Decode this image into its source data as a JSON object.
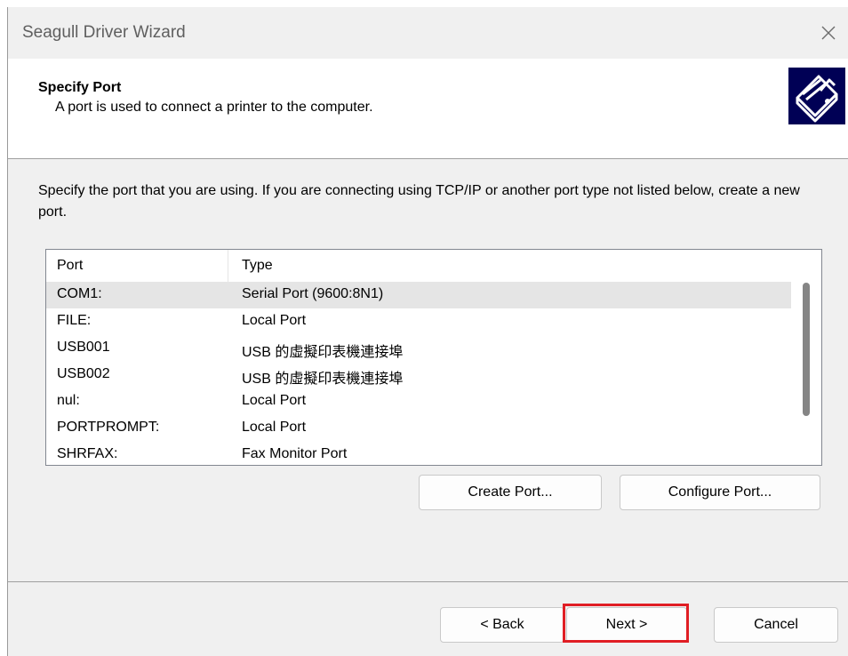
{
  "window": {
    "title": "Seagull Driver Wizard"
  },
  "header": {
    "title": "Specify Port",
    "subtitle": "A port is used to connect a printer to the computer."
  },
  "instructions": "Specify the port that you are using.  If you are connecting using TCP/IP or another port type not listed below, create a new port.",
  "port_list": {
    "columns": [
      "Port",
      "Type"
    ],
    "rows": [
      {
        "port": "COM1:",
        "type": "Serial Port (9600:8N1)",
        "selected": true
      },
      {
        "port": "FILE:",
        "type": "Local Port"
      },
      {
        "port": "USB001",
        "type": "USB 的虛擬印表機連接埠"
      },
      {
        "port": "USB002",
        "type": "USB 的虛擬印表機連接埠"
      },
      {
        "port": "nul:",
        "type": "Local Port"
      },
      {
        "port": "PORTPROMPT:",
        "type": "Local Port"
      },
      {
        "port": "SHRFAX:",
        "type": "Fax Monitor Port"
      }
    ]
  },
  "buttons": {
    "create_port": "Create Port...",
    "configure_port": "Configure Port...",
    "back": "< Back",
    "next": "Next >",
    "cancel": "Cancel"
  },
  "icons": {
    "close": "close-icon",
    "header": "printer-icon"
  },
  "colors": {
    "highlight": "#e01e24",
    "header_icon_bg": "#000055",
    "selected_row": "#e5e5e5"
  }
}
